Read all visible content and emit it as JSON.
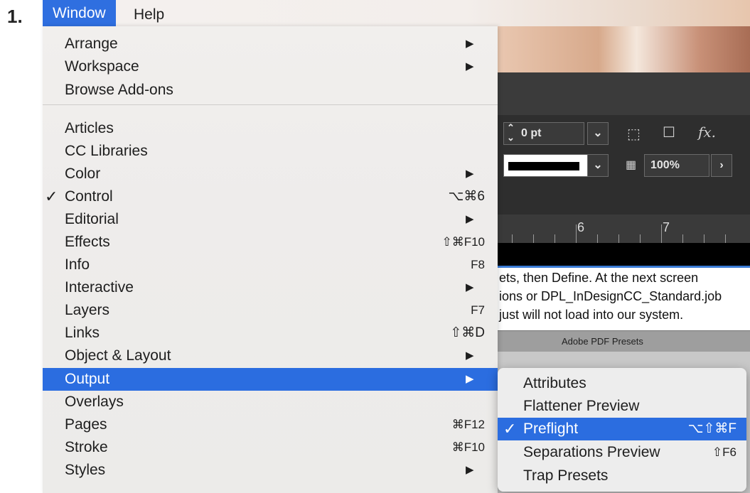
{
  "step_number": "1.",
  "menubar": {
    "items": [
      {
        "label": "Window",
        "active": true
      },
      {
        "label": "Help",
        "active": false
      }
    ]
  },
  "background": {
    "control": {
      "stroke_value": "0 pt",
      "opacity_value": "100%",
      "fx_label": "fx."
    },
    "ruler": {
      "numbers": [
        "6",
        "7"
      ]
    },
    "document_lines": [
      "ets, then Define.  At the next screen",
      "ions or DPL_InDesignCC_Standard.job",
      "just will not load into our system."
    ],
    "pdf_presets_title": "Adobe PDF Presets"
  },
  "window_menu": {
    "items": [
      {
        "label": "Arrange",
        "submenu": true,
        "shortcut": "",
        "checked": false
      },
      {
        "label": "Workspace",
        "submenu": true,
        "shortcut": "",
        "checked": false
      },
      {
        "label": "Browse Add-ons",
        "submenu": false,
        "shortcut": "",
        "checked": false
      },
      {
        "label": "Articles",
        "submenu": false,
        "shortcut": "",
        "checked": false
      },
      {
        "label": "CC Libraries",
        "submenu": false,
        "shortcut": "",
        "checked": false
      },
      {
        "label": "Color",
        "submenu": true,
        "shortcut": "",
        "checked": false
      },
      {
        "label": "Control",
        "submenu": false,
        "shortcut": "⌥⌘6",
        "checked": true
      },
      {
        "label": "Editorial",
        "submenu": true,
        "shortcut": "",
        "checked": false
      },
      {
        "label": "Effects",
        "submenu": false,
        "shortcut": "⇧⌘F10",
        "checked": false
      },
      {
        "label": "Info",
        "submenu": false,
        "shortcut": "F8",
        "checked": false
      },
      {
        "label": "Interactive",
        "submenu": true,
        "shortcut": "",
        "checked": false
      },
      {
        "label": "Layers",
        "submenu": false,
        "shortcut": "F7",
        "checked": false
      },
      {
        "label": "Links",
        "submenu": false,
        "shortcut": "⇧⌘D",
        "checked": false
      },
      {
        "label": "Object & Layout",
        "submenu": true,
        "shortcut": "",
        "checked": false
      },
      {
        "label": "Output",
        "submenu": true,
        "shortcut": "",
        "checked": false,
        "highlighted": true
      },
      {
        "label": "Overlays",
        "submenu": false,
        "shortcut": "",
        "checked": false
      },
      {
        "label": "Pages",
        "submenu": false,
        "shortcut": "⌘F12",
        "checked": false
      },
      {
        "label": "Stroke",
        "submenu": false,
        "shortcut": "⌘F10",
        "checked": false
      },
      {
        "label": "Styles",
        "submenu": true,
        "shortcut": "",
        "checked": false
      }
    ],
    "check_glyph": "✓",
    "arrow_glyph": "▶"
  },
  "output_submenu": {
    "items": [
      {
        "label": "Attributes",
        "shortcut": "",
        "checked": false
      },
      {
        "label": "Flattener Preview",
        "shortcut": "",
        "checked": false
      },
      {
        "label": "Preflight",
        "shortcut": "⌥⇧⌘F",
        "checked": true,
        "highlighted": true
      },
      {
        "label": "Separations Preview",
        "shortcut": "⇧F6",
        "checked": false
      },
      {
        "label": "Trap Presets",
        "shortcut": "",
        "checked": false
      }
    ]
  },
  "colors": {
    "highlight": "#2b6de0",
    "menu_background": "#eeeceb",
    "app_dark": "#2e2e2e"
  }
}
